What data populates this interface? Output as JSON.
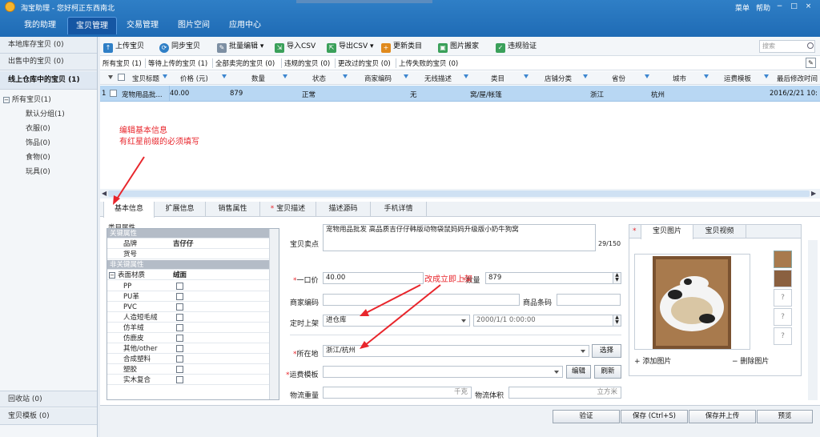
{
  "titlebar": {
    "app_title": "淘宝助理 - 您好柯正东西南北",
    "menu": "菜单",
    "help": "帮助",
    "minimize": "−",
    "maximize": "□",
    "close": "×"
  },
  "nav": {
    "tabs": [
      "我的助理",
      "宝贝管理",
      "交易管理",
      "图片空间",
      "应用中心"
    ],
    "active_index": 1
  },
  "sidebar": {
    "sections": [
      "本地库存宝贝 (0)",
      "出售中的宝贝 (0)",
      "线上仓库中的宝贝 (1)"
    ],
    "tree_root": "所有宝贝(1)",
    "tree_items": [
      "默认分组(1)",
      "衣服(0)",
      "饰品(0)",
      "食物(0)",
      "玩具(0)"
    ],
    "bottom": [
      "回收站 (0)",
      "宝贝模板 (0)"
    ]
  },
  "toolbar": {
    "buttons": [
      "上传宝贝",
      "同步宝贝",
      "批量编辑",
      "导入CSV",
      "导出CSV",
      "更新类目",
      "图片搬家",
      "违规验证"
    ],
    "search_placeholder": "搜索"
  },
  "subtabs": [
    "所有宝贝 (1)",
    "等待上传的宝贝 (1)",
    "全部卖完的宝贝 (0)",
    "违规的宝贝 (0)",
    "更改过的宝贝 (0)",
    "上传失败的宝贝 (0)"
  ],
  "grid": {
    "headers": [
      "宝贝标题",
      "价格 (元)",
      "数量",
      "状态",
      "商家编码",
      "无线描述",
      "类目",
      "店铺分类",
      "省份",
      "城市",
      "运费模板",
      "最后修改时间"
    ],
    "row": {
      "index": "1",
      "title": "宠物用品批...",
      "price": "40.00",
      "qty": "879",
      "status": "正常",
      "code": "",
      "wireless": "无",
      "category": "窝/屋/帐篷",
      "shopcat": "",
      "province": "浙江",
      "city": "杭州",
      "template": "",
      "modified": "2016/2/21 10:"
    }
  },
  "annotations": {
    "note1_line1": "编辑基本信息",
    "note1_line2": "有红星前缀的必须填写",
    "note2": "改成立即上架"
  },
  "detail_tabs": [
    "基本信息",
    "扩展信息",
    "销售属性",
    "宝贝描述",
    "描述源码",
    "手机详情"
  ],
  "props": {
    "title": "类目属性",
    "group1": "关键属性",
    "brand_label": "品牌",
    "brand_value": "吉仔仔",
    "model_label": "货号",
    "group2": "非关键属性",
    "material_label": "表面材质",
    "material_value": "绒面",
    "options": [
      "PP",
      "PU革",
      "PVC",
      "人造短毛绒",
      "仿羊绒",
      "仿鹿皮",
      "其他/other",
      "合成塑料",
      "塑胶",
      "实木复合"
    ]
  },
  "form": {
    "title_label": "宝贝卖点",
    "title_value": "宠物用品批发 高品质吉仔仔韩版动物袋鼠妈妈升级版小奶牛狗窝",
    "title_count": "29/150",
    "price_label": "一口价",
    "price_value": "40.00",
    "qty_label": "数量",
    "qty_value": "879",
    "code_label": "商家编码",
    "barcode_label": "商品条码",
    "shelf_label": "定时上架",
    "shelf_value": "进仓库",
    "shelf_time": "2000/1/1 0:00:00",
    "location_label": "所在地",
    "location_value": "浙江/杭州",
    "select_btn": "选择",
    "template_label": "运费模板",
    "edit_btn": "编辑",
    "refresh_btn": "刷新",
    "weight_label": "物流重量",
    "weight_unit": "千克",
    "volume_label": "物流体积",
    "volume_unit": "立方米"
  },
  "image_panel": {
    "tab_images": "宝贝图片",
    "tab_video": "宝贝视频",
    "add": "添加图片",
    "delete": "删除图片",
    "placeholder": "?"
  },
  "bottom_buttons": [
    "验证",
    "保存 (Ctrl+S)",
    "保存并上传",
    "预览"
  ],
  "colors": {
    "titlebar": "#2f7fc6",
    "accent": "#3d86cf",
    "selected_row": "#b8d7f3",
    "annotation": "#e8262c"
  }
}
